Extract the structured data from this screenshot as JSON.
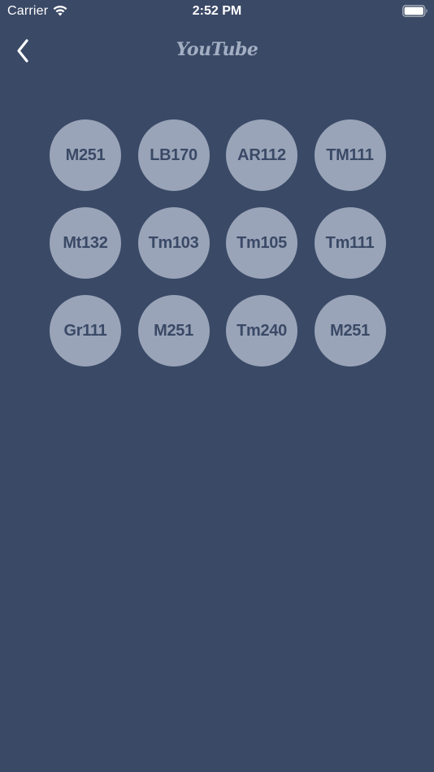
{
  "status_bar": {
    "carrier": "Carrier",
    "time": "2:52 PM",
    "icons": [
      "wifi-icon",
      "battery-icon"
    ]
  },
  "nav": {
    "title": "YouTube",
    "back_icon": "chevron-left-icon"
  },
  "colors": {
    "background": "#3a4966",
    "circle": "#9aa4b8",
    "circle_text": "#3a4966",
    "title": "#a3aec2"
  },
  "buttons": [
    {
      "label": "M251"
    },
    {
      "label": "LB170"
    },
    {
      "label": "AR112"
    },
    {
      "label": "TM111"
    },
    {
      "label": "Mt132"
    },
    {
      "label": "Tm103"
    },
    {
      "label": "Tm105"
    },
    {
      "label": "Tm111"
    },
    {
      "label": "Gr111"
    },
    {
      "label": "M251"
    },
    {
      "label": "Tm240"
    },
    {
      "label": "M251"
    }
  ]
}
